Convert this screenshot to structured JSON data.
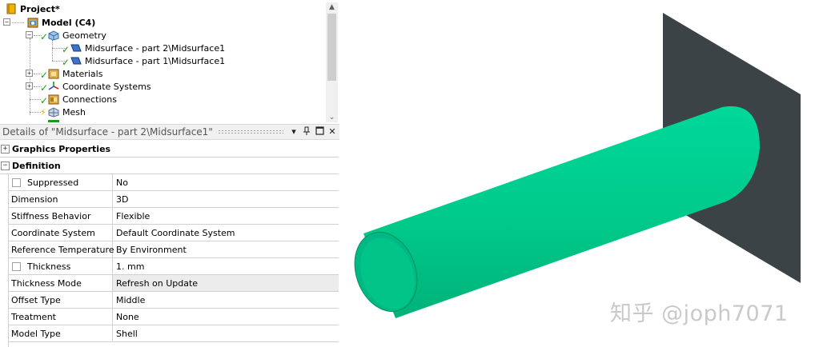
{
  "tree": {
    "project_label": "Project*",
    "model_label": "Model (C4)",
    "geometry_label": "Geometry",
    "part2_label": "Midsurface - part 2\\Midsurface1",
    "part1_label": "Midsurface - part 1\\Midsurface1",
    "materials_label": "Materials",
    "coordinate_systems_label": "Coordinate Systems",
    "connections_label": "Connections",
    "mesh_label": "Mesh"
  },
  "details": {
    "title": "Details of \"Midsurface - part 2\\Midsurface1\"",
    "pin_glyph": "▾",
    "groups": {
      "graphics_properties": "Graphics Properties",
      "definition": "Definition"
    },
    "rows": [
      {
        "name": "Suppressed",
        "value": "No"
      },
      {
        "name": "Dimension",
        "value": "3D"
      },
      {
        "name": "Stiffness Behavior",
        "value": "Flexible"
      },
      {
        "name": "Coordinate System",
        "value": "Default Coordinate System"
      },
      {
        "name": "Reference Temperature",
        "value": "By Environment"
      },
      {
        "name": "Thickness",
        "value": "1. mm"
      },
      {
        "name": "Thickness Mode",
        "value": "Refresh on Update"
      },
      {
        "name": "Offset Type",
        "value": "Middle"
      },
      {
        "name": "Treatment",
        "value": "None"
      },
      {
        "name": "Model Type",
        "value": "Shell"
      }
    ]
  },
  "viewport": {
    "watermark": "知乎 @joph7071"
  },
  "colors": {
    "cylinder": "#00cc88",
    "plate": "#3c4346",
    "check": "#1a9c1a"
  },
  "icons": {
    "project": "project-book-icon",
    "model": "model-icon",
    "geometry": "geometry-icon",
    "body": "surface-body-icon",
    "materials": "materials-icon",
    "coordinate_systems": "coordinate-systems-icon",
    "connections": "connections-icon",
    "mesh": "mesh-icon"
  }
}
